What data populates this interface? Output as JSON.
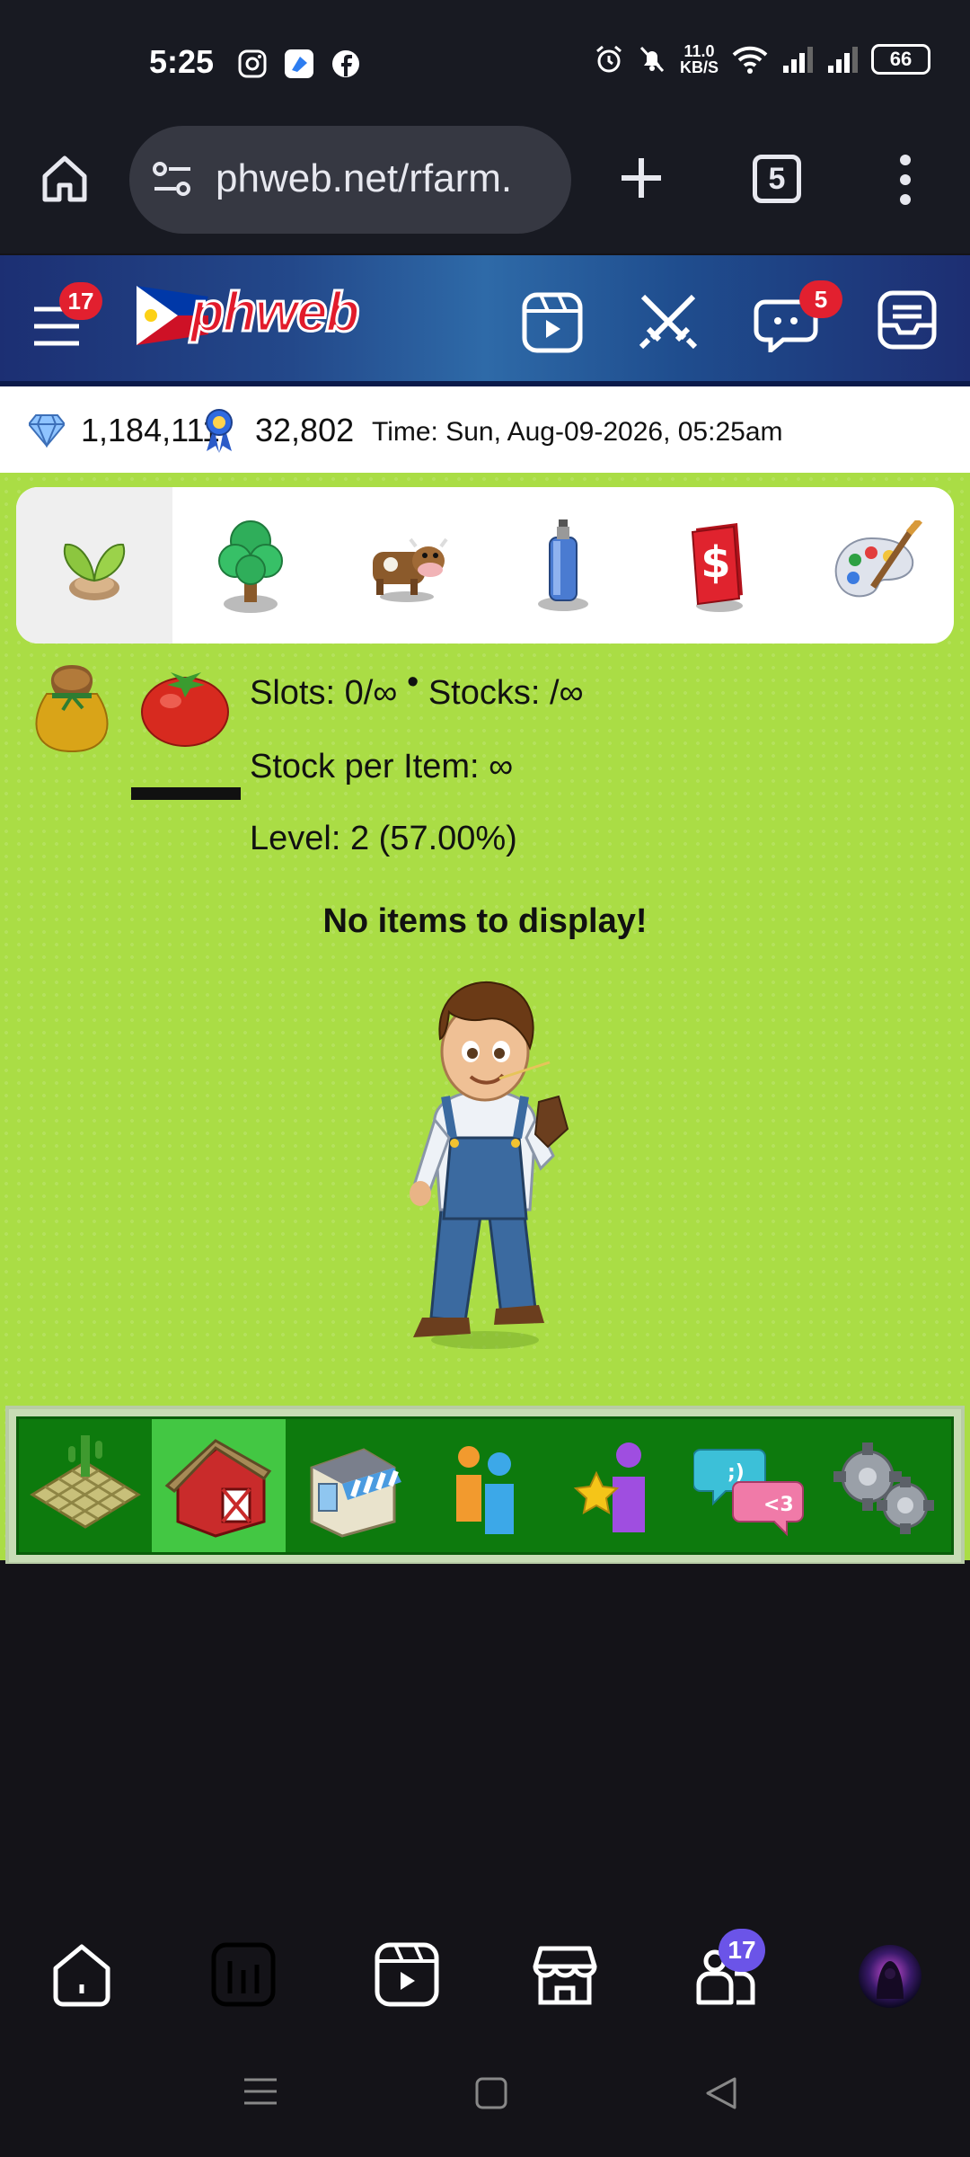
{
  "status_bar": {
    "time": "5:25",
    "net_speed_value": "11.0",
    "net_speed_unit": "KB/S",
    "battery": "66"
  },
  "browser": {
    "url": "phweb.net/rfarm.",
    "tab_count": "5"
  },
  "header": {
    "logo_text": "phweb",
    "menu_badge": "17",
    "chat_badge": "5"
  },
  "stats": {
    "diamonds": "1,184,111",
    "ribbons": "32,802",
    "time_text": "Time: Sun, Aug-09-2026, 05:25am"
  },
  "inventory": {
    "slots": "Slots: 0/∞",
    "stocks": "Stocks: /∞",
    "separator": "•",
    "stock_per_item": "Stock per Item: ∞",
    "level": "Level: 2 (57.00%)",
    "empty_message": "No items to display!"
  },
  "bottom_nav": {
    "friends_badge": "17"
  },
  "colors": {
    "game_bg": "#aadd45",
    "toolbar_green": "#0d7a0d",
    "toolbar_active": "#43c743",
    "badge_red": "#e2202f",
    "nav_badge_purple": "#6b54e8"
  }
}
